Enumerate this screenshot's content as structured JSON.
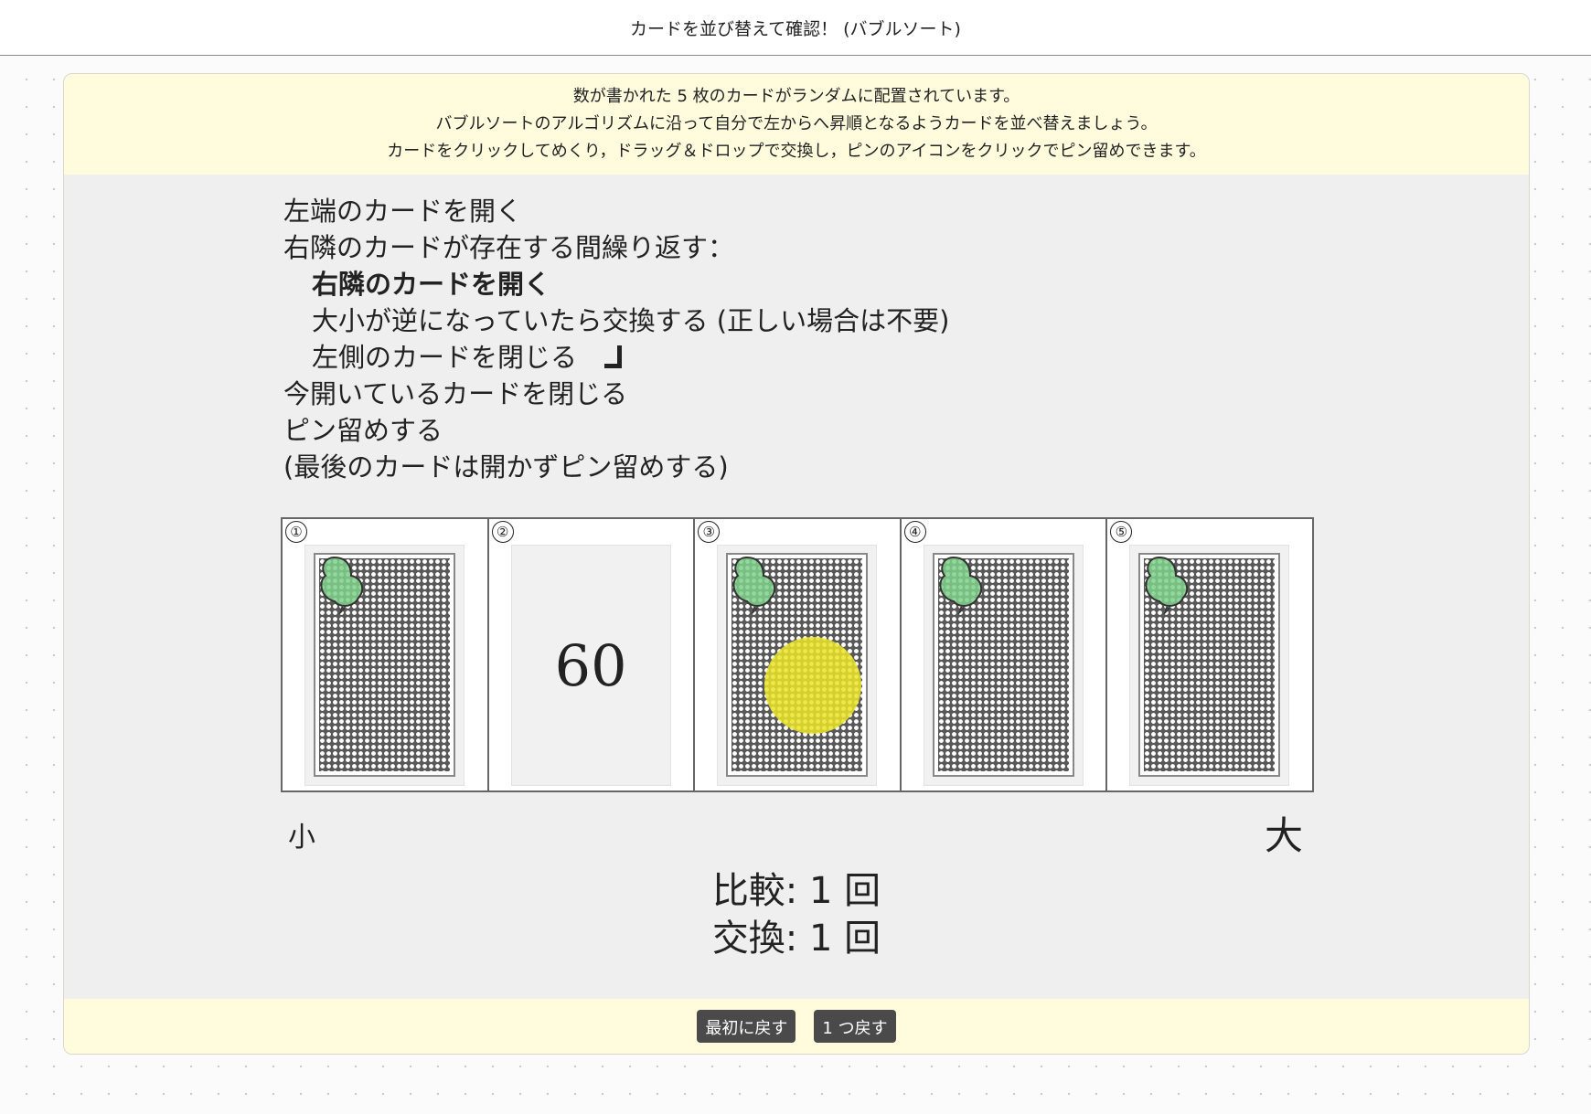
{
  "page": {
    "title": "カードを並び替えて確認！ (バブルソート)"
  },
  "instructions": [
    "数が書かれた 5 枚のカードがランダムに配置されています。",
    "バブルソートのアルゴリズムに沿って自分で左からへ昇順となるようカードを並べ替えましょう。",
    "カードをクリックしてめくり，ドラッグ＆ドロップで交換し，ピンのアイコンをクリックでピン留めできます。"
  ],
  "algorithm_steps": [
    {
      "text": "左端のカードを開く"
    },
    {
      "text": "右隣のカードが存在する間繰り返す："
    },
    {
      "text": "右隣のカードを開く"
    },
    {
      "text": "大小が逆になっていたら交換する (正しい場合は不要)"
    },
    {
      "text": "左側のカードを閉じる"
    },
    {
      "text": "今開いているカードを閉じる"
    },
    {
      "text": "ピン留めする"
    },
    {
      "text": "(最後のカードは開かずピン留めする)"
    }
  ],
  "cards": [
    {
      "position": "①",
      "state": "face-down",
      "value": "",
      "pinned": true,
      "highlighted": false
    },
    {
      "position": "②",
      "state": "face-up",
      "value": "60",
      "pinned": false,
      "highlighted": false
    },
    {
      "position": "③",
      "state": "face-down",
      "value": "",
      "pinned": true,
      "highlighted": true
    },
    {
      "position": "④",
      "state": "face-down",
      "value": "",
      "pinned": true,
      "highlighted": false
    },
    {
      "position": "⑤",
      "state": "face-down",
      "value": "",
      "pinned": true,
      "highlighted": false
    }
  ],
  "scale_labels": {
    "small": "小",
    "large": "大"
  },
  "counters": {
    "comparisons": "比較: 1 回",
    "swaps": "交換: 1 回"
  },
  "buttons": {
    "reset": "最初に戻す",
    "undo": "1 つ戻す"
  },
  "colors": {
    "header_bg": "#fffbdd",
    "panel_bg": "#efefef",
    "button_bg": "#4a4a4a",
    "pin_green": "#7fd08a",
    "highlight_yellow": "#ebe428"
  }
}
